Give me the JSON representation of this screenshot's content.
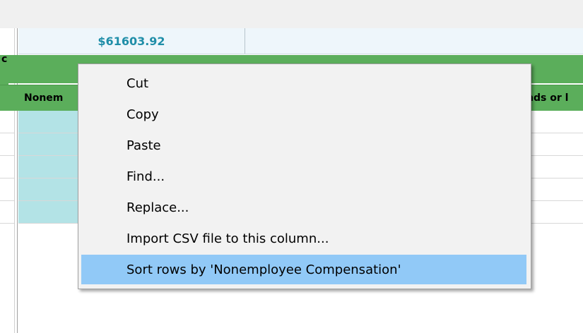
{
  "grid": {
    "total_amount": "$61603.92",
    "group_edge_text": "c",
    "column_headers": {
      "left": "Nonem",
      "right": "nds or l"
    }
  },
  "context_menu": {
    "items": [
      {
        "label": "Cut"
      },
      {
        "label": "Copy"
      },
      {
        "label": "Paste"
      },
      {
        "label": "Find..."
      },
      {
        "label": "Replace..."
      },
      {
        "label": "Import CSV file to this column..."
      },
      {
        "label": "Sort rows by 'Nonemployee Compensation'",
        "highlighted": true
      }
    ]
  },
  "colors": {
    "group_header_green": "#5bae5b",
    "total_text": "#1f8ea8",
    "teal_cell": "#b3e3e6",
    "menu_highlight": "#91c9f7",
    "menu_background": "#f2f2f2"
  }
}
